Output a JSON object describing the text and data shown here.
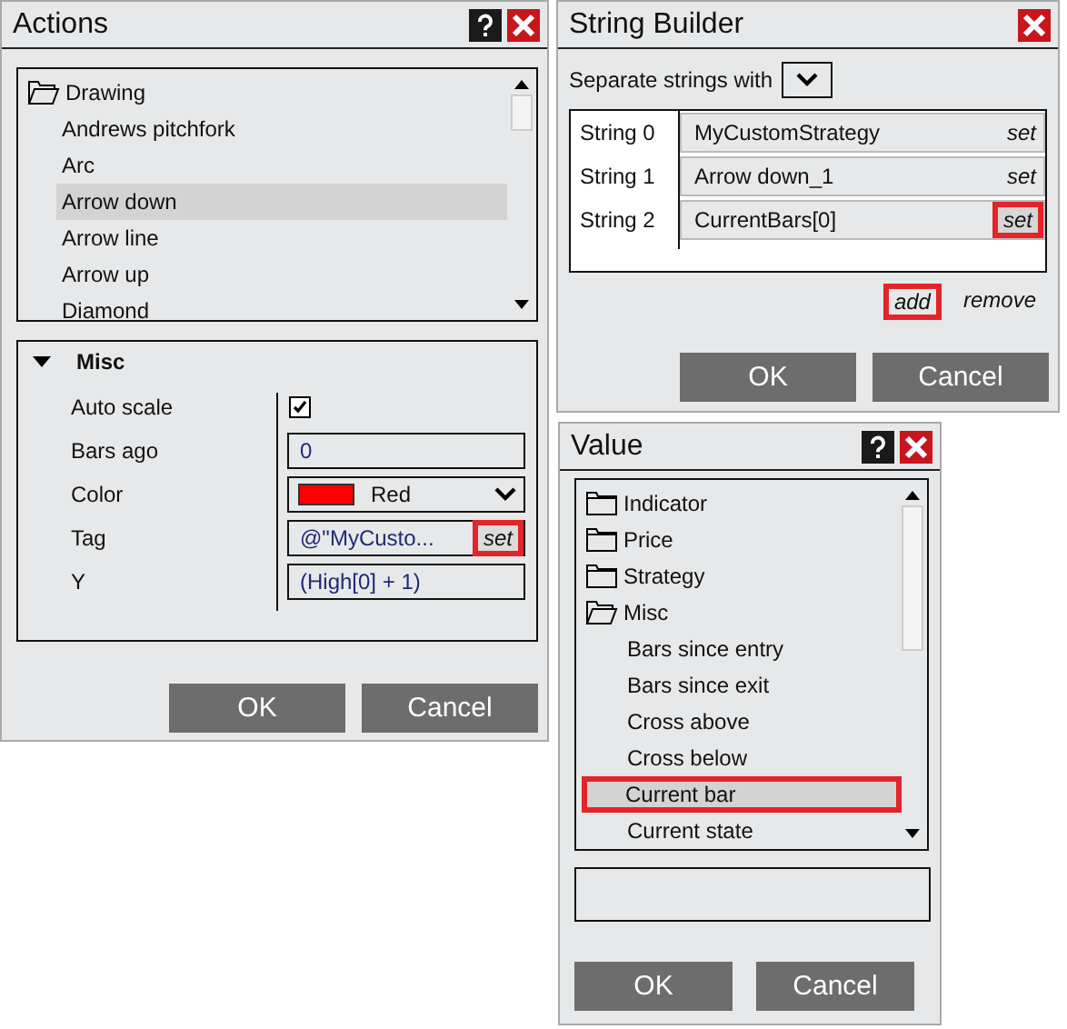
{
  "actions": {
    "title": "Actions",
    "tree": [
      {
        "label": "Drawing",
        "expanded": true,
        "children": [
          {
            "label": "Andrews pitchfork",
            "selected": false
          },
          {
            "label": "Arc",
            "selected": false
          },
          {
            "label": "Arrow down",
            "selected": true
          },
          {
            "label": "Arrow line",
            "selected": false
          },
          {
            "label": "Arrow up",
            "selected": false
          },
          {
            "label": "Diamond",
            "selected": false
          }
        ]
      }
    ],
    "misc": {
      "title": "Misc",
      "expanded": true,
      "properties": [
        {
          "kind": "checkbox",
          "label": "Auto scale",
          "checked": true
        },
        {
          "kind": "text",
          "label": "Bars ago",
          "value": "0"
        },
        {
          "kind": "color",
          "label": "Color",
          "value": "Red",
          "color": "#ff0000"
        },
        {
          "kind": "set",
          "label": "Tag",
          "value": "@\"MyCusto...",
          "button": "set",
          "highlighted": true
        },
        {
          "kind": "text",
          "label": "Y",
          "value": "(High[0] + 1)"
        }
      ]
    },
    "buttons": [
      "OK",
      "Cancel"
    ]
  },
  "string_builder": {
    "title": "String Builder",
    "separator_label": "Separate strings with",
    "strings": [
      {
        "label": "String 0",
        "value": "MyCustomStrategy",
        "button": "set",
        "highlighted": false
      },
      {
        "label": "String 1",
        "value": "Arrow down_1",
        "button": "set",
        "highlighted": false
      },
      {
        "label": "String 2",
        "value": "CurrentBars[0]",
        "button": "set",
        "highlighted": true
      }
    ],
    "links": [
      {
        "label": "add",
        "highlighted": true
      },
      {
        "label": "remove",
        "highlighted": false
      }
    ],
    "buttons": [
      "OK",
      "Cancel"
    ]
  },
  "value": {
    "title": "Value",
    "tree": [
      {
        "label": "Indicator",
        "expanded": false
      },
      {
        "label": "Price",
        "expanded": false
      },
      {
        "label": "Strategy",
        "expanded": false
      },
      {
        "label": "Misc",
        "expanded": true,
        "children": [
          {
            "label": "Bars since entry",
            "selected": false,
            "highlighted": false
          },
          {
            "label": "Bars since exit",
            "selected": false,
            "highlighted": false
          },
          {
            "label": "Cross above",
            "selected": false,
            "highlighted": false
          },
          {
            "label": "Cross below",
            "selected": false,
            "highlighted": false
          },
          {
            "label": "Current bar",
            "selected": true,
            "highlighted": true
          },
          {
            "label": "Current state",
            "selected": false,
            "highlighted": false
          }
        ]
      }
    ],
    "buttons": [
      "OK",
      "Cancel"
    ]
  }
}
